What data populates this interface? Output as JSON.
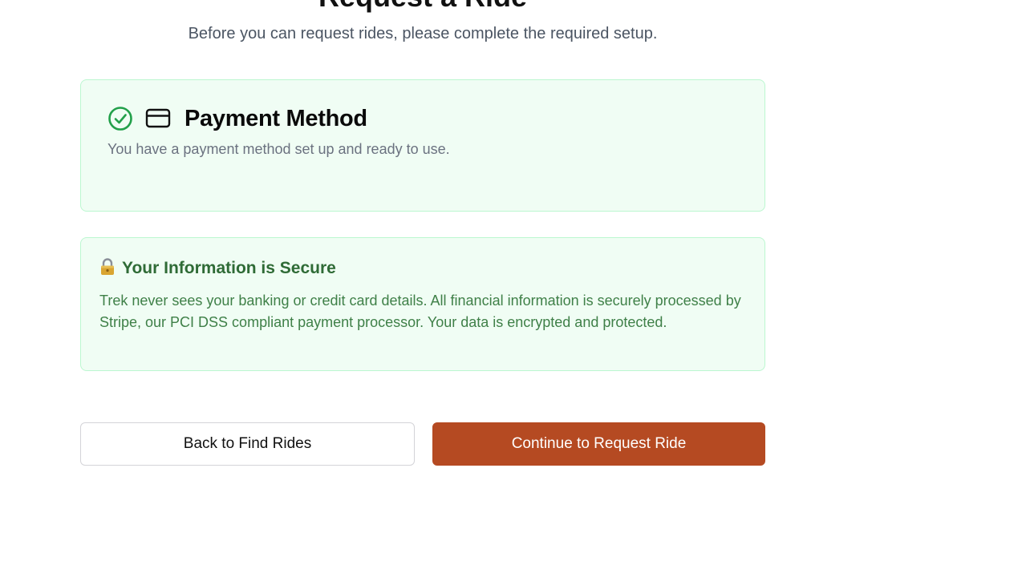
{
  "header": {
    "title": "Request a Ride",
    "subtitle": "Before you can request rides, please complete the required setup."
  },
  "payment_card": {
    "status_icon": "check-circle-icon",
    "card_icon": "credit-card-icon",
    "title": "Payment Method",
    "description": "You have a payment method set up and ready to use."
  },
  "secure_card": {
    "icon": "lock-icon",
    "title": "Your Information is Secure",
    "body": "Trek never sees your banking or credit card details. All financial information is securely processed by Stripe, our PCI DSS compliant payment processor. Your data is encrypted and protected."
  },
  "actions": {
    "back_label": "Back to Find Rides",
    "continue_label": "Continue to Request Ride"
  },
  "colors": {
    "success_bg": "#f0fdf4",
    "success_border": "#bbf7d0",
    "success_icon": "#22a04a",
    "secure_text": "#2f6b36",
    "primary_button": "#b54a22"
  }
}
